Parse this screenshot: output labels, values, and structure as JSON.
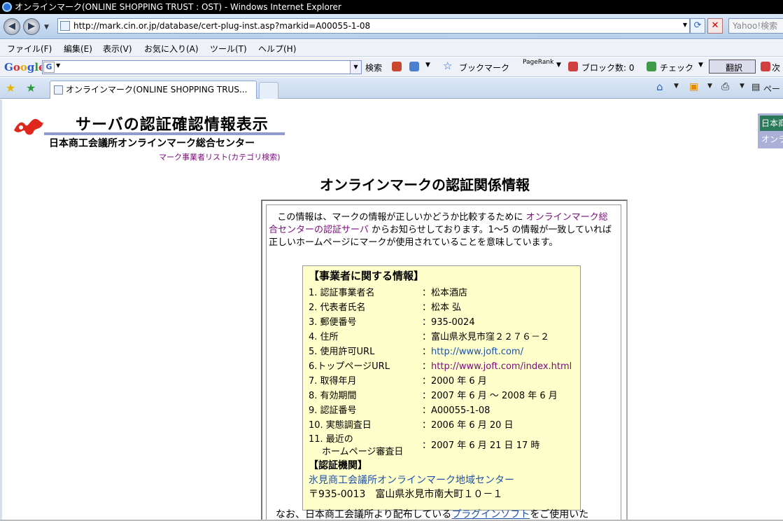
{
  "window": {
    "title": "オンラインマーク(ONLINE SHOPPING TRUST : OST) - Windows Internet Explorer"
  },
  "address_bar": {
    "url": "http://mark.cin.or.jp/database/cert-plug-inst.asp?markid=A00055-1-08",
    "search_placeholder": "Yahoo!検索"
  },
  "menu": [
    "ファイル(F)",
    "編集(E)",
    "表示(V)",
    "お気に入り(A)",
    "ツール(T)",
    "ヘルプ(H)"
  ],
  "google_toolbar": {
    "logo": "Google",
    "search_label": "検索",
    "bookmarks": "ブックマーク",
    "pagerank": "PageRank",
    "block_count": "ブロック数: 0",
    "check": "チェック",
    "translate": "翻訳",
    "next": "次"
  },
  "tab": {
    "title": "オンラインマーク(ONLINE SHOPPING TRUS..."
  },
  "page_tools": {
    "page": "ペー"
  },
  "header": {
    "title": "サーバの認証確認情報表示",
    "subtitle": "日本商工会議所オンラインマーク総合センター",
    "list_link": "マーク事業者リスト(カテゴリ検索)"
  },
  "sidenav": {
    "item1": "日本商",
    "item2": "オンラ"
  },
  "main": {
    "title": "オンラインマークの認証関係情報",
    "intro_pre": "この情報は、マークの情報が正しいかどうか比較するために",
    "intro_link": "オンラインマーク総合センターの認証サーバ",
    "intro_post": "からお知らせしております。1～5 の情報が一致していれば正しいホームページにマークが使用されていることを意味しています。",
    "section_title": "【事業者に関する情報】",
    "rows": [
      {
        "label": "1. 認証事業者名",
        "value": "：松本酒店"
      },
      {
        "label": "2. 代表者氏名",
        "value": "：松本 弘"
      },
      {
        "label": "3. 郵便番号",
        "value": "：935-0024"
      },
      {
        "label": "4. 住所",
        "value": "：富山県氷見市窪２２７６－２"
      },
      {
        "label": "5. 使用許可URL",
        "value_prefix": "：",
        "value_link": "http://www.joft.com/"
      },
      {
        "label": "6.トップページURL",
        "value_prefix": "：",
        "value_link": "http://www.joft.com/index.html"
      },
      {
        "label": "7. 取得年月",
        "value": "：2000 年 6 月"
      },
      {
        "label": "8. 有効期間",
        "value": "：2007 年 6 月 ～ 2008 年 6 月"
      },
      {
        "label": "9. 認証番号",
        "value": "：A00055-1-08"
      },
      {
        "label": "10. 実態調査日",
        "value": "：2006 年 6 月 20 日"
      },
      {
        "label": "11. 最近の",
        "label2": "ホームページ審査日",
        "value": "：2007 年 6 月 21 日 17 時"
      }
    ],
    "auth_title": "【認証機関】",
    "auth_org": "氷見商工会議所オンラインマーク地域センター",
    "auth_address": "〒935-0013　富山県氷見市南大町１０－１",
    "footer_pre": "なお、日本商工会議所より配布している",
    "footer_link": "プラグインソフト",
    "footer_post": "をご使用いた"
  }
}
